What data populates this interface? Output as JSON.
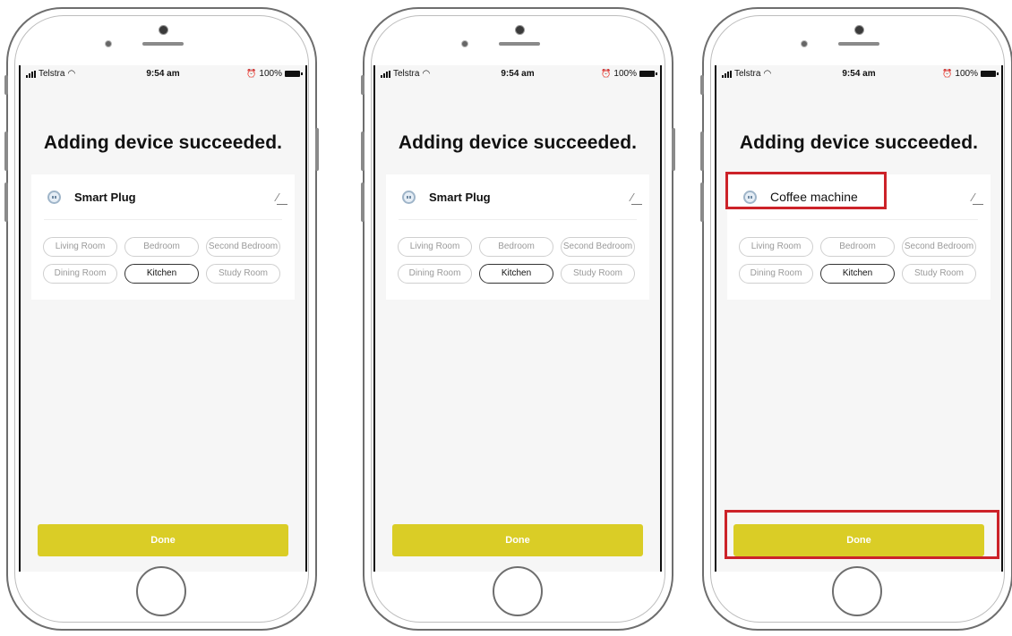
{
  "phones": [
    {
      "status": {
        "carrier": "Telstra",
        "time": "9:54 am",
        "battery": "100%"
      },
      "title": "Adding device succeeded.",
      "device_name": "Smart Plug",
      "rooms": [
        {
          "label": "Living Room",
          "selected": false
        },
        {
          "label": "Bedroom",
          "selected": false
        },
        {
          "label": "Second Bedroom",
          "selected": false
        },
        {
          "label": "Dining Room",
          "selected": false
        },
        {
          "label": "Kitchen",
          "selected": true
        },
        {
          "label": "Study Room",
          "selected": false
        }
      ],
      "done_label": "Done"
    },
    {
      "status": {
        "carrier": "Telstra",
        "time": "9:54 am",
        "battery": "100%"
      },
      "title": "Adding device succeeded.",
      "device_name": "Smart Plug",
      "rooms": [
        {
          "label": "Living Room",
          "selected": false
        },
        {
          "label": "Bedroom",
          "selected": false
        },
        {
          "label": "Second Bedroom",
          "selected": false
        },
        {
          "label": "Dining Room",
          "selected": false
        },
        {
          "label": "Kitchen",
          "selected": true
        },
        {
          "label": "Study Room",
          "selected": false
        }
      ],
      "done_label": "Done"
    },
    {
      "status": {
        "carrier": "Telstra",
        "time": "9:54 am",
        "battery": "100%"
      },
      "title": "Adding device succeeded.",
      "device_name": "Coffee machine",
      "rooms": [
        {
          "label": "Living Room",
          "selected": false
        },
        {
          "label": "Bedroom",
          "selected": false
        },
        {
          "label": "Second Bedroom",
          "selected": false
        },
        {
          "label": "Dining Room",
          "selected": false
        },
        {
          "label": "Kitchen",
          "selected": true
        },
        {
          "label": "Study Room",
          "selected": false
        }
      ],
      "done_label": "Done"
    }
  ],
  "colors": {
    "done_button": "#dacd26",
    "highlight": "#cc2229",
    "screen_bg": "#f6f6f6"
  },
  "icons": [
    "signal-icon",
    "wifi-icon",
    "alarm-icon",
    "battery-icon",
    "smart-plug-icon",
    "pencil-icon"
  ]
}
